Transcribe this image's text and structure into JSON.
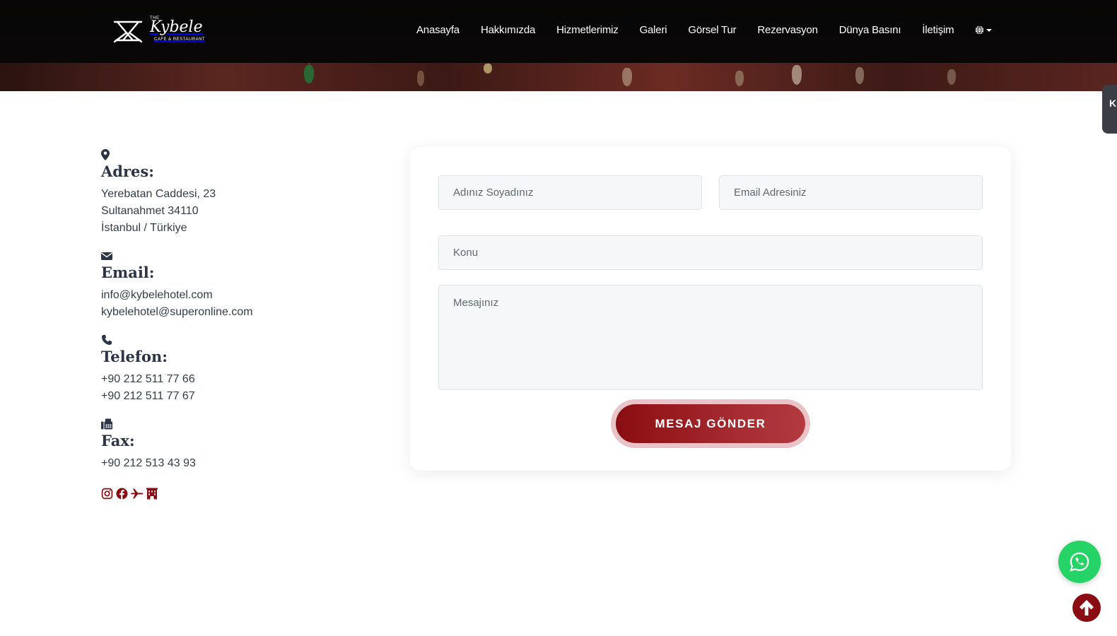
{
  "brand": {
    "logo_the": "THE",
    "logo_name": "Kybele",
    "logo_sub": "CAFE & RESTAURANT"
  },
  "nav": {
    "items": [
      {
        "label": "Anasayfa"
      },
      {
        "label": "Hakkımızda"
      },
      {
        "label": "Hizmetlerimiz"
      },
      {
        "label": "Galeri"
      },
      {
        "label": "Görsel Tur"
      },
      {
        "label": "Rezervasyon"
      },
      {
        "label": "Dünya Basını"
      },
      {
        "label": "İletişim"
      }
    ],
    "language_icon": "globe-icon"
  },
  "side_tab": {
    "label": "K"
  },
  "contact": {
    "address": {
      "icon": "map-marker-icon",
      "heading": "Adres:",
      "lines": [
        "Yerebatan Caddesi, 23",
        "Sultanahmet 34110",
        "İstanbul / Türkiye"
      ]
    },
    "email": {
      "icon": "envelope-icon",
      "heading": "Email:",
      "lines": [
        "info@kybelehotel.com",
        "kybelehotel@superonline.com"
      ]
    },
    "phone": {
      "icon": "phone-icon",
      "heading": "Telefon:",
      "lines": [
        "+90 212 511 77 66",
        "+90 212 511 77 67"
      ]
    },
    "fax": {
      "icon": "fax-icon",
      "heading": "Fax:",
      "lines": [
        "+90 212 513 43 93"
      ]
    },
    "socials": [
      "instagram-icon",
      "facebook-icon",
      "plane-icon",
      "hotel-icon"
    ],
    "social_color": "#8b0d14"
  },
  "form": {
    "name_placeholder": "Adınız Soyadınız",
    "email_placeholder": "Email Adresiniz",
    "subject_placeholder": "Konu",
    "message_placeholder": "Mesajınız",
    "submit_label": "MESAJ GÖNDER"
  },
  "floating": {
    "whatsapp_icon": "whatsapp-icon",
    "whatsapp_color": "#25d366",
    "back_to_top_icon": "arrow-up-icon",
    "back_to_top_color": "#8b0d14"
  }
}
